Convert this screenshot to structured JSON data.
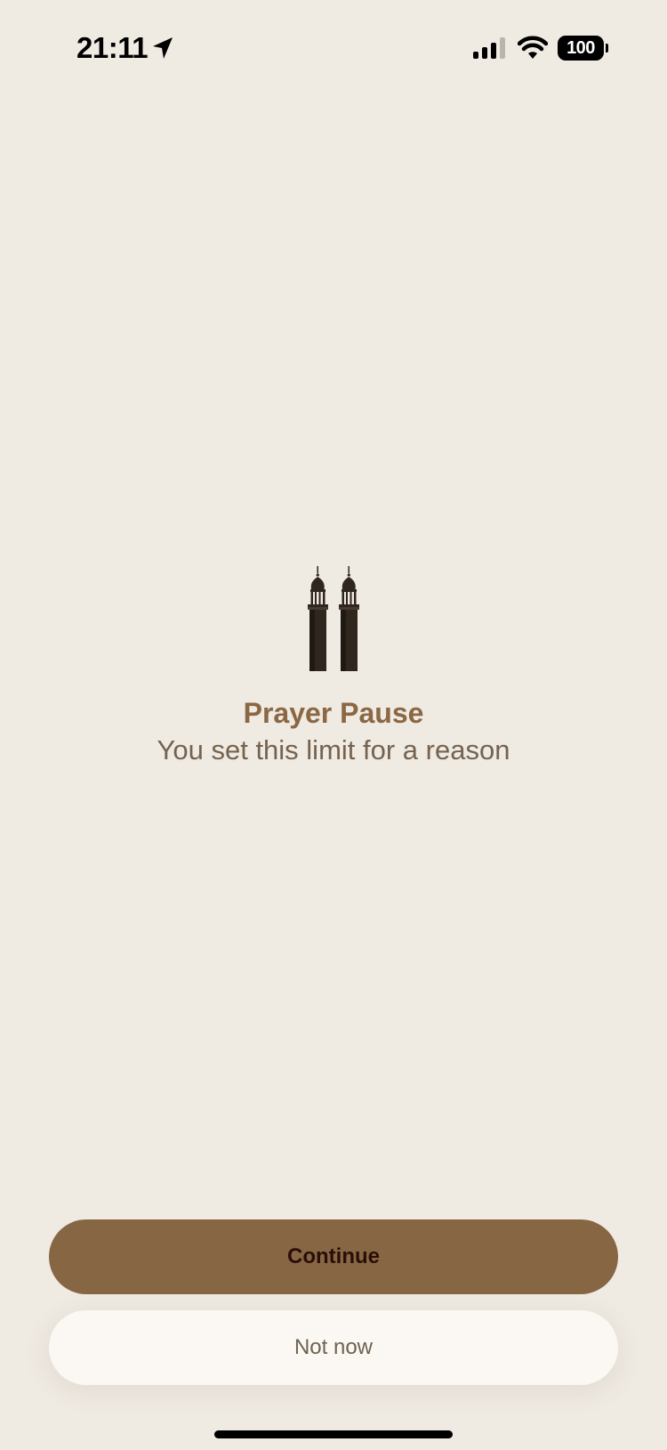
{
  "status_bar": {
    "time": "21:11",
    "battery": "100",
    "icons": [
      "location-arrow-icon",
      "cellular-signal-icon",
      "wifi-icon",
      "battery-icon"
    ]
  },
  "main": {
    "icon": "twin-minarets-icon",
    "title": "Prayer Pause",
    "subtitle": "You set this limit for a reason"
  },
  "actions": {
    "continue_label": "Continue",
    "not_now_label": "Not now"
  },
  "colors": {
    "background": "#efeae2",
    "title": "#8b6744",
    "subtitle": "#76634f",
    "continue_bg": "#876644",
    "continue_text": "#2a0e08",
    "not_now_bg": "#fbf8f3",
    "not_now_text": "#6f6252",
    "minaret": "#2f261e"
  }
}
